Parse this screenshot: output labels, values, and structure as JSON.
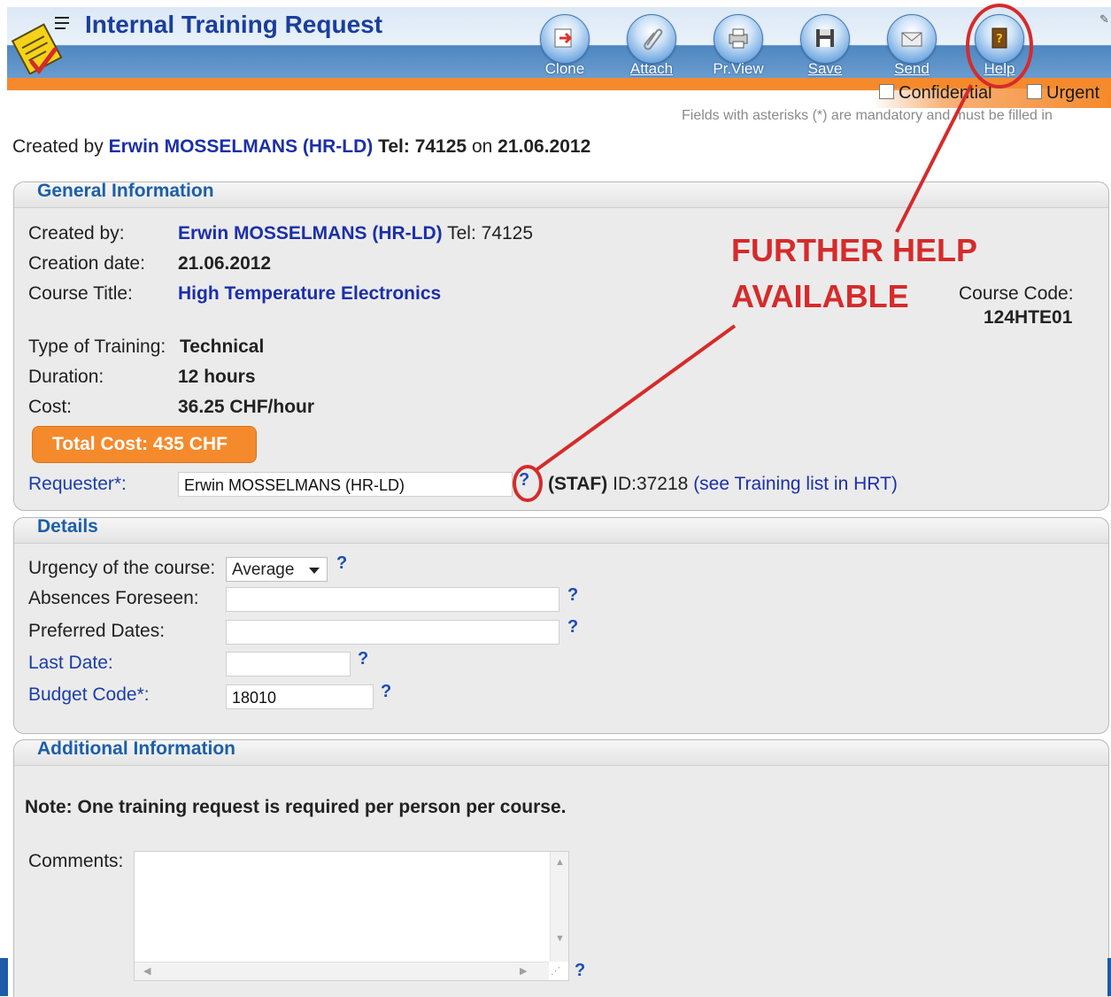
{
  "header": {
    "title": "Internal Training Request",
    "toolbar": [
      {
        "label": "Clone",
        "icon": "clone-icon"
      },
      {
        "label": "Attach",
        "icon": "paperclip-icon"
      },
      {
        "label": "Pr.View",
        "icon": "print-preview-icon"
      },
      {
        "label": "Save",
        "icon": "floppy-disk-icon"
      },
      {
        "label": "Send",
        "icon": "envelope-icon"
      },
      {
        "label": "Help",
        "icon": "help-book-icon"
      }
    ],
    "confidential_label": "Confidential",
    "urgent_label": "Urgent",
    "mandatory_note": "Fields with asterisks (*) are mandatory and must be filled in"
  },
  "created_line": {
    "prefix": "Created by",
    "name": "Erwin MOSSELMANS (HR-LD)",
    "tel": "Tel: 74125",
    "on": "on",
    "date": "21.06.2012"
  },
  "general": {
    "title": "General Information",
    "created_by_label": "Created by:",
    "created_by_name": "Erwin MOSSELMANS (HR-LD)",
    "created_by_tel": "Tel: 74125",
    "creation_date_label": "Creation date:",
    "creation_date": "21.06.2012",
    "course_title_label": "Course Title:",
    "course_title": "High Temperature Electronics",
    "course_code_label": "Course Code:",
    "course_code": "124HTE01",
    "type_label": "Type of Training:",
    "type": "Technical",
    "duration_label": "Duration:",
    "duration": "12 hours",
    "cost_label": "Cost:",
    "cost": "36.25 CHF/hour",
    "total_cost": "Total Cost: 435 CHF",
    "requester_label": "Requester*:",
    "requester_value": "Erwin MOSSELMANS (HR-LD)",
    "staf": "(STAF)",
    "staf_id": "ID:37218",
    "training_link": "(see Training list in HRT)"
  },
  "details": {
    "title": "Details",
    "urgency_label": "Urgency of the course:",
    "urgency_value": "Average",
    "absences_label": "Absences Foreseen:",
    "absences_value": "",
    "preferred_label": "Preferred Dates:",
    "preferred_value": "",
    "last_date_label": "Last Date:",
    "last_date_value": "",
    "budget_label": "Budget Code*:",
    "budget_value": "18010"
  },
  "additional": {
    "title": "Additional Information",
    "note": "Note: One training request is required per person per course.",
    "comments_label": "Comments:",
    "comments_value": ""
  },
  "help_glyph": "?",
  "annotation": {
    "line1": "FURTHER HELP",
    "line2": "AVAILABLE",
    "color": "#d52b2b"
  },
  "colors": {
    "accent_orange": "#f58a2c",
    "header_blue": "#4f87c1",
    "link_blue": "#1b2fa8",
    "title_blue": "#1b3e9a"
  }
}
